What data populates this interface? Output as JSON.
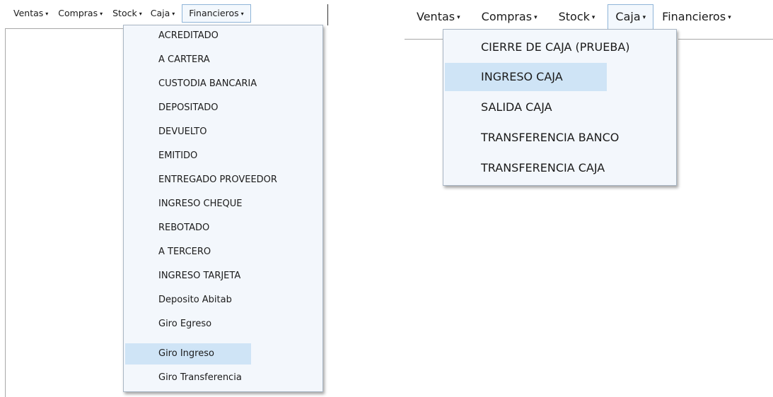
{
  "left": {
    "menubar": [
      {
        "label": "Ventas",
        "arrow": "▾"
      },
      {
        "label": "Compras",
        "arrow": "▾"
      },
      {
        "label": "Stock",
        "arrow": "▾"
      },
      {
        "label": "Caja",
        "arrow": "▾"
      },
      {
        "label": "Financieros",
        "arrow": "▾"
      }
    ],
    "open_menu": "Financieros",
    "dropdown_items": [
      "ACREDITADO",
      "A CARTERA",
      "CUSTODIA BANCARIA",
      "DEPOSITADO",
      "DEVUELTO",
      "EMITIDO",
      "ENTREGADO PROVEEDOR",
      "INGRESO CHEQUE",
      "REBOTADO",
      "A TERCERO",
      "INGRESO TARJETA",
      "Deposito Abitab",
      "Giro Egreso",
      "Giro Ingreso",
      "Giro Transferencia"
    ],
    "highlighted_item": "Giro Ingreso"
  },
  "right": {
    "menubar": [
      {
        "label": "Ventas",
        "arrow": "▾"
      },
      {
        "label": "Compras",
        "arrow": "▾"
      },
      {
        "label": "Stock",
        "arrow": "▾"
      },
      {
        "label": "Caja",
        "arrow": "▾"
      },
      {
        "label": "Financieros",
        "arrow": "▾"
      }
    ],
    "open_menu": "Caja",
    "dropdown_items": [
      "CIERRE DE CAJA (PRUEBA)",
      "INGRESO CAJA",
      "SALIDA CAJA",
      "TRANSFERENCIA BANCO",
      "TRANSFERENCIA CAJA"
    ],
    "highlighted_item": "INGRESO CAJA"
  },
  "colors": {
    "dropdown_bg": "#f3f7fc",
    "highlight": "#cfe4f6",
    "open_menu_border": "#8fb4d8"
  }
}
